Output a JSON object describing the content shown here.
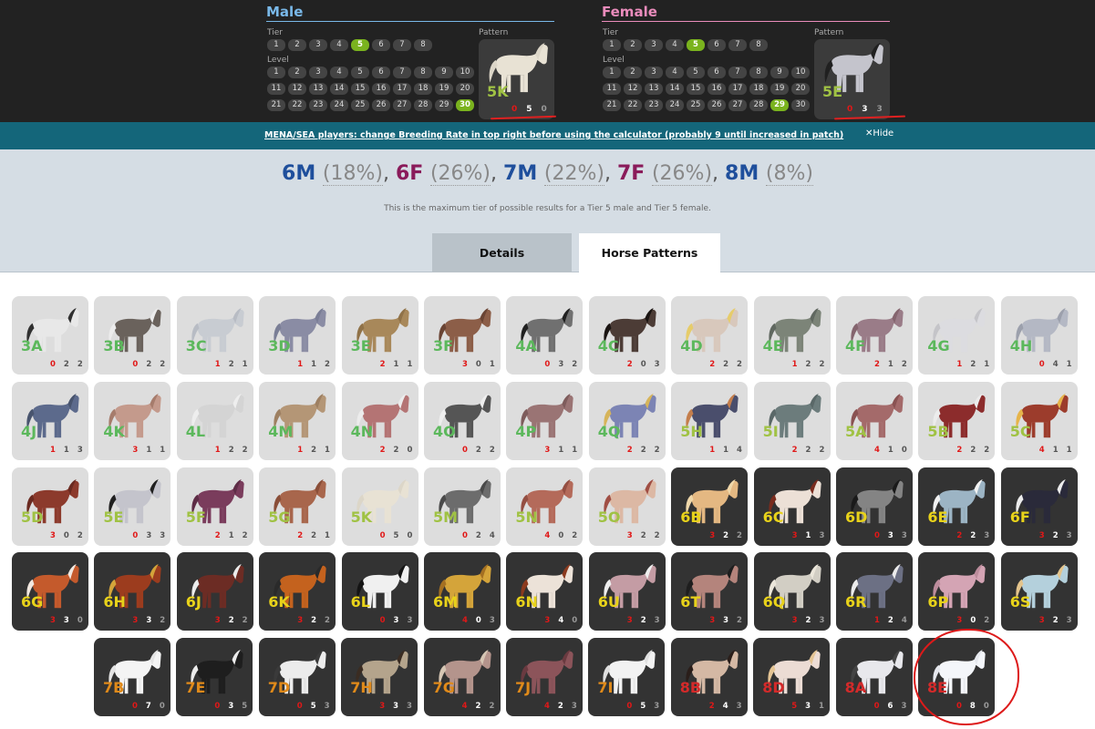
{
  "male": {
    "title": "Male",
    "tier_label": "Tier",
    "level_label": "Level",
    "pattern_label": "Pattern",
    "tiers": [
      "1",
      "2",
      "3",
      "4",
      "5",
      "6",
      "7",
      "8"
    ],
    "selected_tier": "5",
    "levels": [
      "1",
      "2",
      "3",
      "4",
      "5",
      "6",
      "7",
      "8",
      "9",
      "10",
      "11",
      "12",
      "13",
      "14",
      "15",
      "16",
      "17",
      "18",
      "19",
      "20",
      "21",
      "22",
      "23",
      "24",
      "25",
      "26",
      "27",
      "28",
      "29",
      "30"
    ],
    "selected_level": "30",
    "pattern": {
      "code": "5K",
      "color": "#a0c244",
      "stats": [
        "0",
        "5",
        "0"
      ],
      "body": "#e8e2d4",
      "mane": "#dcd6c8"
    }
  },
  "female": {
    "title": "Female",
    "tier_label": "Tier",
    "level_label": "Level",
    "pattern_label": "Pattern",
    "tiers": [
      "1",
      "2",
      "3",
      "4",
      "5",
      "6",
      "7",
      "8"
    ],
    "selected_tier": "5",
    "levels": [
      "1",
      "2",
      "3",
      "4",
      "5",
      "6",
      "7",
      "8",
      "9",
      "10",
      "11",
      "12",
      "13",
      "14",
      "15",
      "16",
      "17",
      "18",
      "19",
      "20",
      "21",
      "22",
      "23",
      "24",
      "25",
      "26",
      "27",
      "28",
      "29",
      "30"
    ],
    "selected_level": "29",
    "pattern": {
      "code": "5E",
      "color": "#a0c244",
      "stats": [
        "0",
        "3",
        "3"
      ],
      "body": "#c4c4cc",
      "mane": "#202020"
    }
  },
  "notice": {
    "message": "MENA/SEA players: change Breeding Rate in top right before using the calculator (probably 9 until increased in patch)",
    "hide_label": "Hide"
  },
  "results": {
    "items": [
      {
        "code": "6M",
        "pct": "(18%)",
        "color": "#1f4f9c"
      },
      {
        "code": "6F",
        "pct": "(26%)",
        "color": "#8a1b5a"
      },
      {
        "code": "7M",
        "pct": "(22%)",
        "color": "#1f4f9c"
      },
      {
        "code": "7F",
        "pct": "(26%)",
        "color": "#8a1b5a"
      },
      {
        "code": "8M",
        "pct": "(8%)",
        "color": "#1f4f9c"
      }
    ],
    "caption": "This is the maximum tier of possible results for a Tier 5 male and Tier 5 female."
  },
  "tabs": {
    "details": "Details",
    "patterns": "Horse Patterns"
  },
  "colors": {
    "tier3_4": "#5cb85c",
    "tier5": "#a0c244",
    "tier6": "#e8d21a",
    "tier7": "#e08a1a",
    "tier8": "#d42a2a",
    "accent_active": "#7ab31e",
    "notice_bg": "#14667a"
  },
  "horses": [
    {
      "code": "3A",
      "tier": 3,
      "stats": [
        "0",
        "2",
        "2"
      ],
      "body": "#e8e8e8",
      "mane": "#303030"
    },
    {
      "code": "3B",
      "tier": 3,
      "stats": [
        "0",
        "2",
        "2"
      ],
      "body": "#6a625c",
      "mane": "#ececec"
    },
    {
      "code": "3C",
      "tier": 3,
      "stats": [
        "1",
        "2",
        "1"
      ],
      "body": "#c8ccd2",
      "mane": "#b8bcc4"
    },
    {
      "code": "3D",
      "tier": 3,
      "stats": [
        "1",
        "1",
        "2"
      ],
      "body": "#8a8ca4",
      "mane": "#7a7e96"
    },
    {
      "code": "3E",
      "tier": 3,
      "stats": [
        "2",
        "1",
        "1"
      ],
      "body": "#a8885a",
      "mane": "#907248"
    },
    {
      "code": "3F",
      "tier": 3,
      "stats": [
        "3",
        "0",
        "1"
      ],
      "body": "#8c5e48",
      "mane": "#6a4434"
    },
    {
      "code": "4A",
      "tier": 4,
      "stats": [
        "0",
        "3",
        "2"
      ],
      "body": "#707070",
      "mane": "#202020"
    },
    {
      "code": "4C",
      "tier": 4,
      "stats": [
        "2",
        "0",
        "3"
      ],
      "body": "#4c3c36",
      "mane": "#1a1412"
    },
    {
      "code": "4D",
      "tier": 4,
      "stats": [
        "2",
        "2",
        "2"
      ],
      "body": "#d8c8bc",
      "mane": "#e6cc6a"
    },
    {
      "code": "4E",
      "tier": 4,
      "stats": [
        "1",
        "2",
        "2"
      ],
      "body": "#7c8478",
      "mane": "#606860"
    },
    {
      "code": "4F",
      "tier": 4,
      "stats": [
        "2",
        "1",
        "2"
      ],
      "body": "#9a7c88",
      "mane": "#84646e"
    },
    {
      "code": "4G",
      "tier": 4,
      "stats": [
        "1",
        "2",
        "1"
      ],
      "body": "#dcdce0",
      "mane": "#c4c4c8"
    },
    {
      "code": "4H",
      "tier": 4,
      "stats": [
        "0",
        "4",
        "1"
      ],
      "body": "#b4b8c4",
      "mane": "#9ca0ac"
    },
    {
      "code": "4J",
      "tier": 4,
      "stats": [
        "1",
        "1",
        "3"
      ],
      "body": "#5c6a8c",
      "mane": "#48546e"
    },
    {
      "code": "4K",
      "tier": 4,
      "stats": [
        "3",
        "1",
        "1"
      ],
      "body": "#c49a8c",
      "mane": "#a67c6c"
    },
    {
      "code": "4L",
      "tier": 4,
      "stats": [
        "1",
        "2",
        "2"
      ],
      "body": "#d4d4d4",
      "mane": "#eeeeee"
    },
    {
      "code": "4M",
      "tier": 4,
      "stats": [
        "1",
        "2",
        "1"
      ],
      "body": "#b49676",
      "mane": "#9e8062"
    },
    {
      "code": "4N",
      "tier": 4,
      "stats": [
        "2",
        "2",
        "0"
      ],
      "body": "#b47474",
      "mane": "#ececec"
    },
    {
      "code": "4O",
      "tier": 4,
      "stats": [
        "0",
        "2",
        "2"
      ],
      "body": "#555555",
      "mane": "#eeeeee"
    },
    {
      "code": "4P",
      "tier": 4,
      "stats": [
        "3",
        "1",
        "1"
      ],
      "body": "#9a7474",
      "mane": "#7e5c5c"
    },
    {
      "code": "4Q",
      "tier": 4,
      "stats": [
        "2",
        "2",
        "2"
      ],
      "body": "#7c84b4",
      "mane": "#d6b45a"
    },
    {
      "code": "5H",
      "tier": 5,
      "stats": [
        "1",
        "1",
        "4"
      ],
      "body": "#4a4e6c",
      "mane": "#c47e4c"
    },
    {
      "code": "5I",
      "tier": 5,
      "stats": [
        "2",
        "2",
        "2"
      ],
      "body": "#6c7c7c",
      "mane": "#5a6868"
    },
    {
      "code": "5A",
      "tier": 5,
      "stats": [
        "4",
        "1",
        "0"
      ],
      "body": "#a46a6a",
      "mane": "#8a5252"
    },
    {
      "code": "5B",
      "tier": 5,
      "stats": [
        "2",
        "2",
        "2"
      ],
      "body": "#8c2c2c",
      "mane": "#ececec"
    },
    {
      "code": "5C",
      "tier": 5,
      "stats": [
        "4",
        "1",
        "1"
      ],
      "body": "#9c3c2c",
      "mane": "#e6b44a"
    },
    {
      "code": "5D",
      "tier": 5,
      "stats": [
        "3",
        "0",
        "2"
      ],
      "body": "#8c3a2c",
      "mane": "#6a2a20"
    },
    {
      "code": "5E",
      "tier": 5,
      "stats": [
        "0",
        "3",
        "3"
      ],
      "body": "#c4c4cc",
      "mane": "#202020"
    },
    {
      "code": "5F",
      "tier": 5,
      "stats": [
        "2",
        "1",
        "2"
      ],
      "body": "#7a3c5c",
      "mane": "#5e2c46"
    },
    {
      "code": "5G",
      "tier": 5,
      "stats": [
        "2",
        "2",
        "1"
      ],
      "body": "#a8664c",
      "mane": "#8a4e38"
    },
    {
      "code": "5K",
      "tier": 5,
      "stats": [
        "0",
        "5",
        "0"
      ],
      "body": "#e8e2d4",
      "mane": "#dcd6c8"
    },
    {
      "code": "5M",
      "tier": 5,
      "stats": [
        "0",
        "2",
        "4"
      ],
      "body": "#6c6c6c",
      "mane": "#4a4a4a"
    },
    {
      "code": "5N",
      "tier": 5,
      "stats": [
        "4",
        "0",
        "2"
      ],
      "body": "#b46a5a",
      "mane": "#944e42"
    },
    {
      "code": "5O",
      "tier": 5,
      "stats": [
        "3",
        "2",
        "2"
      ],
      "body": "#dcb8a4",
      "mane": "#a04e44"
    },
    {
      "code": "6B",
      "tier": 6,
      "stats": [
        "3",
        "2",
        "2"
      ],
      "body": "#e4b882",
      "mane": "#f0d8aa"
    },
    {
      "code": "6C",
      "tier": 6,
      "stats": [
        "3",
        "1",
        "3"
      ],
      "body": "#ece0d6",
      "mane": "#7a2c1e"
    },
    {
      "code": "6D",
      "tier": 6,
      "stats": [
        "0",
        "3",
        "3"
      ],
      "body": "#848484",
      "mane": "#1a1a1a"
    },
    {
      "code": "6E",
      "tier": 6,
      "stats": [
        "2",
        "2",
        "3"
      ],
      "body": "#9cb4c4",
      "mane": "#f2f2f2"
    },
    {
      "code": "6F",
      "tier": 6,
      "stats": [
        "3",
        "2",
        "3"
      ],
      "body": "#2a2a3a",
      "mane": "#ececec"
    },
    {
      "code": "6G",
      "tier": 6,
      "stats": [
        "3",
        "3",
        "0"
      ],
      "body": "#c45a2c",
      "mane": "#f2e8e0"
    },
    {
      "code": "6H",
      "tier": 6,
      "stats": [
        "3",
        "3",
        "2"
      ],
      "body": "#9c3c1e",
      "mane": "#d4a43a"
    },
    {
      "code": "6J",
      "tier": 6,
      "stats": [
        "3",
        "2",
        "2"
      ],
      "body": "#6c2c24",
      "mane": "#ececec"
    },
    {
      "code": "6K",
      "tier": 6,
      "stats": [
        "3",
        "2",
        "2"
      ],
      "body": "#c4621e",
      "mane": "#2a2a2a"
    },
    {
      "code": "6L",
      "tier": 6,
      "stats": [
        "0",
        "3",
        "3"
      ],
      "body": "#f0f0f0",
      "mane": "#141414"
    },
    {
      "code": "6M",
      "tier": 6,
      "stats": [
        "4",
        "0",
        "3"
      ],
      "body": "#d4a43a",
      "mane": "#a47022"
    },
    {
      "code": "6N",
      "tier": 6,
      "stats": [
        "3",
        "4",
        "0"
      ],
      "body": "#ece2d8",
      "mane": "#8c3a1e"
    },
    {
      "code": "6U",
      "tier": 6,
      "stats": [
        "3",
        "2",
        "3"
      ],
      "body": "#c49ca4",
      "mane": "#eeeeee"
    },
    {
      "code": "6T",
      "tier": 6,
      "stats": [
        "3",
        "3",
        "2"
      ],
      "body": "#b4847c",
      "mane": "#1e1e1e"
    },
    {
      "code": "6Q",
      "tier": 6,
      "stats": [
        "3",
        "2",
        "3"
      ],
      "body": "#d2cec4",
      "mane": "#ebe6da"
    },
    {
      "code": "6R",
      "tier": 6,
      "stats": [
        "1",
        "2",
        "4"
      ],
      "body": "#6c7084",
      "mane": "#ececec"
    },
    {
      "code": "6P",
      "tier": 6,
      "stats": [
        "3",
        "0",
        "2"
      ],
      "body": "#d4a4b4",
      "mane": "#bc8c9c"
    },
    {
      "code": "6S",
      "tier": 6,
      "stats": [
        "3",
        "2",
        "3"
      ],
      "body": "#b4d0dc",
      "mane": "#e4c48c"
    },
    {
      "code": "7B",
      "tier": 7,
      "stats": [
        "0",
        "7",
        "0"
      ],
      "body": "#f4f4f4",
      "mane": "#e4e4e4"
    },
    {
      "code": "7E",
      "tier": 7,
      "stats": [
        "0",
        "3",
        "5"
      ],
      "body": "#1e1e1e",
      "mane": "#ececec"
    },
    {
      "code": "7D",
      "tier": 7,
      "stats": [
        "0",
        "5",
        "3"
      ],
      "body": "#ececec",
      "mane": "#3a3a3a"
    },
    {
      "code": "7H",
      "tier": 7,
      "stats": [
        "3",
        "3",
        "3"
      ],
      "body": "#b4a48c",
      "mane": "#3a2c22"
    },
    {
      "code": "7G",
      "tier": 7,
      "stats": [
        "4",
        "2",
        "2"
      ],
      "body": "#b4948c",
      "mane": "#d6c6b4"
    },
    {
      "code": "7J",
      "tier": 7,
      "stats": [
        "4",
        "2",
        "3"
      ],
      "body": "#8c545a",
      "mane": "#6a3a40"
    },
    {
      "code": "7I",
      "tier": 7,
      "stats": [
        "0",
        "5",
        "3"
      ],
      "body": "#f2f2f2",
      "mane": "#e0e0e0"
    },
    {
      "code": "8B",
      "tier": 8,
      "stats": [
        "2",
        "4",
        "3"
      ],
      "body": "#d4b8a4",
      "mane": "#2a1e1a"
    },
    {
      "code": "8D",
      "tier": 8,
      "stats": [
        "5",
        "3",
        "1"
      ],
      "body": "#ecdcd4",
      "mane": "#e4c494"
    },
    {
      "code": "8A",
      "tier": 8,
      "stats": [
        "0",
        "6",
        "3"
      ],
      "body": "#e8e8ec",
      "mane": "#444444"
    },
    {
      "code": "8E",
      "tier": 8,
      "stats": [
        "0",
        "8",
        "0"
      ],
      "body": "#f4f6fa",
      "mane": "#e6e8ee"
    }
  ]
}
